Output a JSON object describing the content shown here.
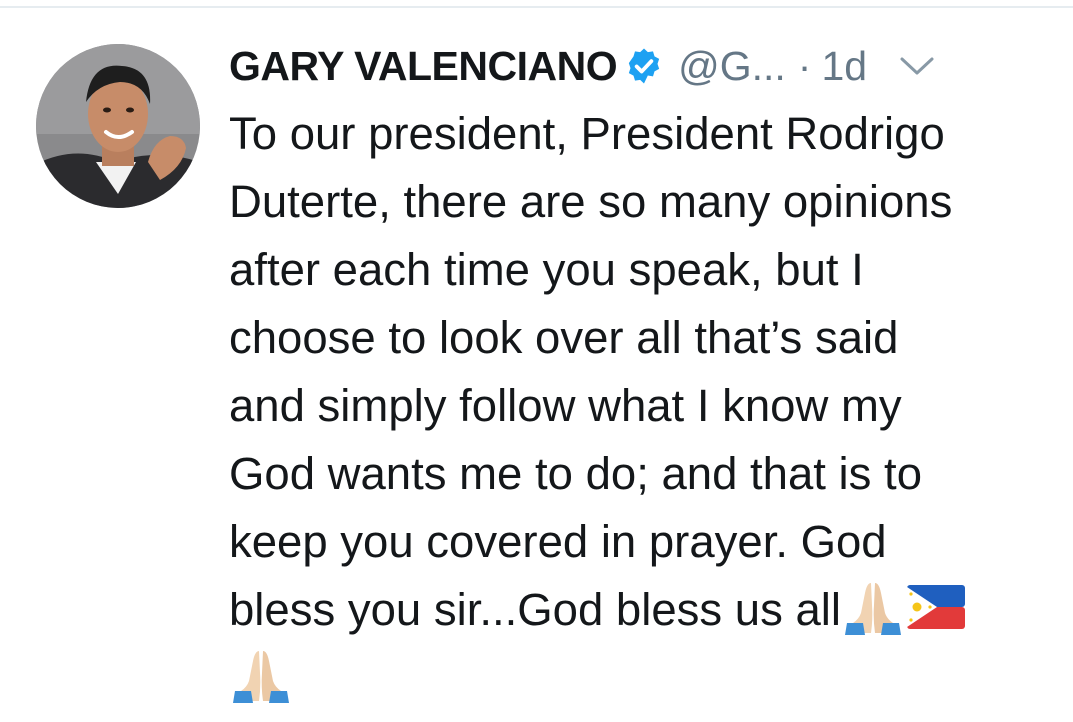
{
  "tweet": {
    "display_name": "GARY VALENCIANO",
    "handle": "@G...",
    "separator": "·",
    "timestamp": "1d",
    "text_lines": [
      "To our president, President Rodrigo",
      "Duterte, there are so many opinions",
      "after each time you speak, but I",
      "choose to look over all that’s said",
      "and simply follow what I know my",
      "God wants me to do; and that is to",
      "keep you covered in prayer. God",
      "bless you sir...God bless us all"
    ],
    "icons": {
      "avatar": "profile-photo",
      "verified": "verified-badge-icon",
      "menu": "chevron-down-icon",
      "emoji_1": "folded-hands-emoji",
      "emoji_2": "philippines-flag-emoji",
      "emoji_3": "folded-hands-emoji"
    },
    "colors": {
      "text": "#14171a",
      "secondary": "#657786",
      "verified": "#1da1f2",
      "divider": "#e6ecf0"
    }
  }
}
